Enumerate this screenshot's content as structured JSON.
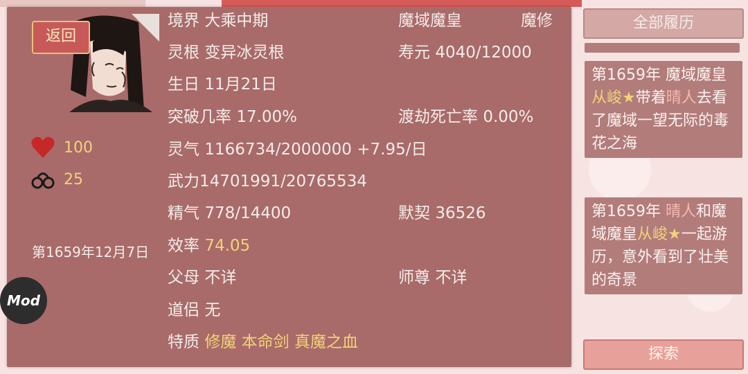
{
  "character": {
    "back_label": "返回",
    "health": "100",
    "bonds": "25",
    "date": "第1659年12月7日",
    "mod_label": "Mod",
    "realm_label": "境界",
    "realm_value": "大乘中期",
    "title": "魔域魔皇",
    "path": "魔修",
    "root_label": "灵根",
    "root_value": "变异冰灵根",
    "lifespan_label": "寿元",
    "lifespan_value": "4040/12000",
    "birthday_label": "生日",
    "birthday_value": "11月21日",
    "breakthrough_label": "突破几率",
    "breakthrough_value": "17.00%",
    "tribulation_label": "渡劫死亡率",
    "tribulation_value": "0.00%",
    "qi_label": "灵气",
    "qi_value": "1166734/2000000 +7.95/日",
    "power_text": "武力14701991/20765534",
    "essence_label": "精气",
    "essence_value": "778/14400",
    "tacit_label": "默契",
    "tacit_value": "36526",
    "efficiency_label": "效率",
    "efficiency_value": "74.05",
    "parents_label": "父母",
    "parents_value": "不详",
    "master_label": "师尊",
    "master_value": "不详",
    "partner_label": "道侣",
    "partner_value": "无",
    "traits_label": "特质",
    "traits": [
      "修魔",
      "本命剑",
      "真魔之血"
    ]
  },
  "sidebar": {
    "all_history_label": "全部履历",
    "explore_label": "探索",
    "logs": [
      {
        "pre": "第1659年 魔域魔皇",
        "name1": "从峻★",
        "mid": "带着",
        "name2": "晴人",
        "post": "去看了魔域一望无际的毒花之海"
      },
      {
        "pre": "第1659年 ",
        "name1": "晴人",
        "mid": "和魔域魔皇",
        "name2": "从峻★",
        "post": "一起游历，意外看到了壮美的奇景"
      }
    ]
  },
  "colors": {
    "panel": "#a86b69",
    "highlight": "#f2d27a",
    "accent_red": "#c62828"
  }
}
